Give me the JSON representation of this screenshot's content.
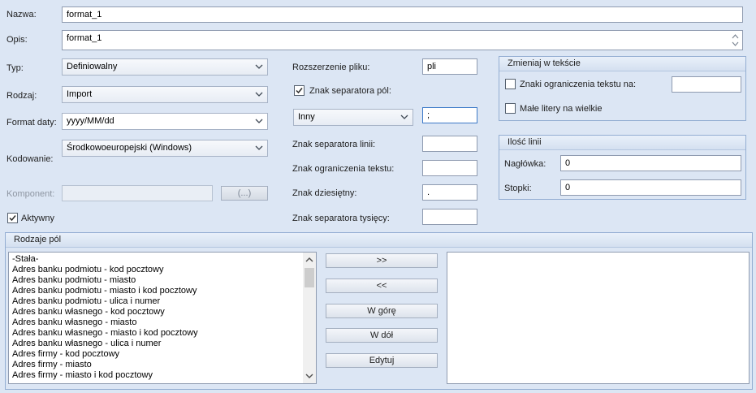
{
  "labels": {
    "nazwa": "Nazwa:",
    "opis": "Opis:",
    "typ": "Typ:",
    "rodzaj": "Rodzaj:",
    "format_daty": "Format daty:",
    "kodowanie": "Kodowanie:",
    "komponent": "Komponent:",
    "aktywny": "Aktywny",
    "rozszerzenie": "Rozszerzenie pliku:",
    "znak_sep_pol": "Znak separatora pól:",
    "znak_sep_linii": "Znak separatora linii:",
    "znak_ogr_tekstu": "Znak ograniczenia tekstu:",
    "znak_dziesietny": "Znak dziesiętny:",
    "znak_sep_tysiecy": "Znak separatora tysięcy:"
  },
  "fields": {
    "nazwa": "format_1",
    "opis": "format_1",
    "typ": "Definiowalny",
    "rodzaj": "Import",
    "format_daty": "yyyy/MM/dd",
    "kodowanie": "Środkowoeuropejski (Windows)",
    "komponent": "",
    "komponent_button": "(...)",
    "rozszerzenie": "pli",
    "separator_type": "Inny",
    "separator_value": ";",
    "sep_linii": "",
    "ogr_tekstu": "",
    "dziesietny": ".",
    "sep_tysiecy": ""
  },
  "checks": {
    "aktywny": true,
    "znak_sep_pol": true,
    "znaki_ograniczenia": false,
    "male_litery": false
  },
  "zmieniaj": {
    "title": "Zmieniaj w tekście",
    "znaki_ograniczenia_label": "Znaki ograniczenia tekstu na:",
    "znaki_ograniczenia_value": "",
    "male_litery_label": "Małe litery na wielkie"
  },
  "ilosc": {
    "title": "Ilość linii",
    "naglowka_label": "Nagłówka:",
    "naglowka_value": "0",
    "stopki_label": "Stopki:",
    "stopki_value": "0"
  },
  "rodzaje": {
    "title": "Rodzaje pól",
    "items": [
      "-Stała-",
      "Adres banku podmiotu - kod pocztowy",
      "Adres banku podmiotu - miasto",
      "Adres banku podmiotu - miasto i kod pocztowy",
      "Adres banku podmiotu - ulica i numer",
      "Adres banku własnego - kod pocztowy",
      "Adres banku własnego - miasto",
      "Adres banku własnego - miasto i kod pocztowy",
      "Adres banku własnego - ulica i numer",
      "Adres firmy - kod pocztowy",
      "Adres firmy - miasto",
      "Adres firmy - miasto i kod pocztowy"
    ],
    "buttons": {
      "add": ">>",
      "remove": "<<",
      "up": "W górę",
      "down": "W dół",
      "edit": "Edytuj"
    }
  }
}
